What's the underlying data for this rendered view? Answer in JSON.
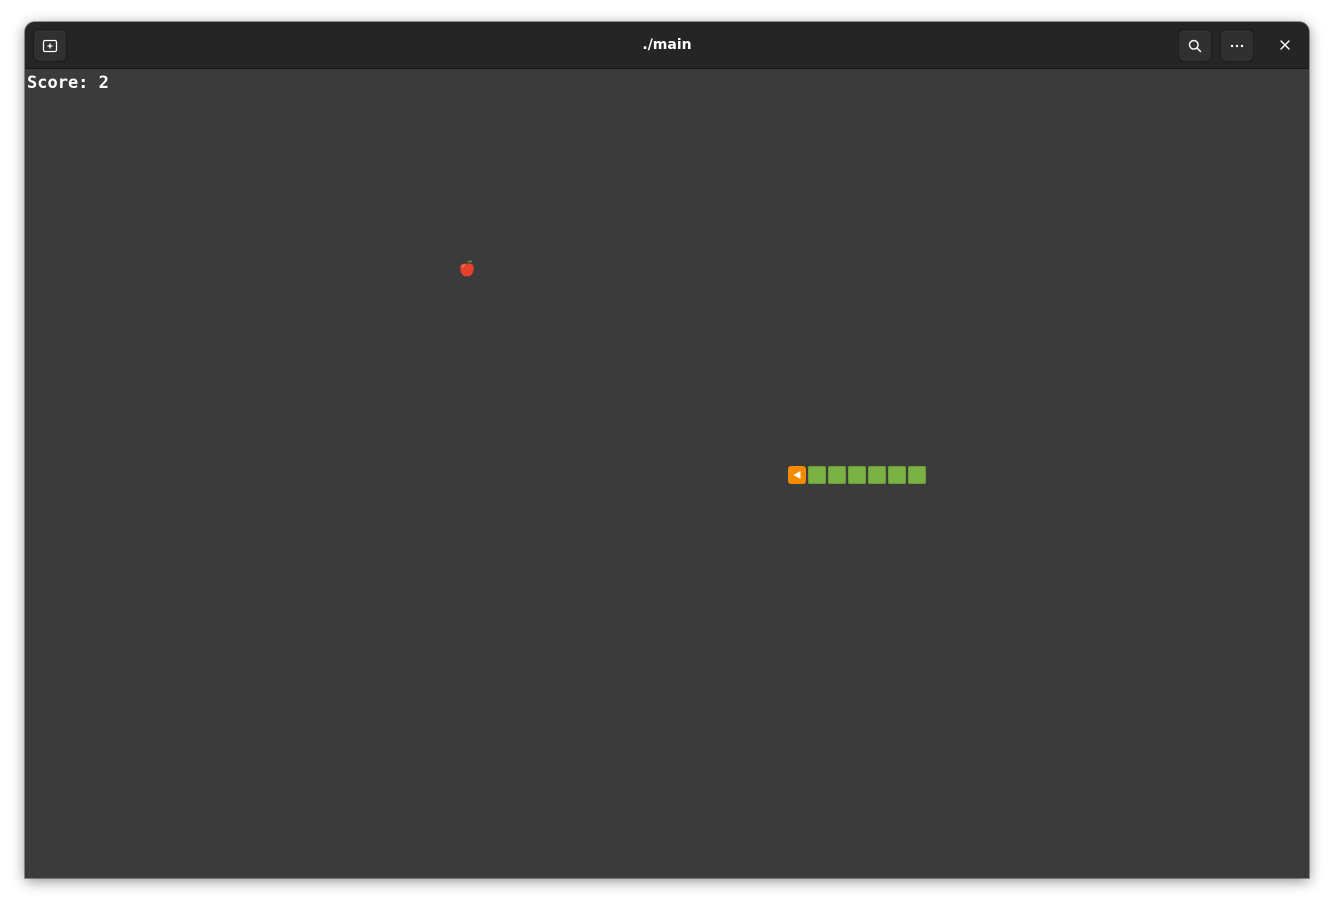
{
  "window": {
    "title": "./main",
    "buttons": {
      "new_tab": "new-tab-icon",
      "search": "search-icon",
      "menu": "more-icon",
      "close": "close-icon"
    }
  },
  "game": {
    "score_label": "Score: 2",
    "score": 2,
    "food": "apple",
    "snake": {
      "direction": "left",
      "head_color": "#f48a00",
      "body_color": "#79b142",
      "body_segments": 6
    }
  },
  "colors": {
    "background": "#3b3b3b",
    "titlebar": "#252525"
  }
}
